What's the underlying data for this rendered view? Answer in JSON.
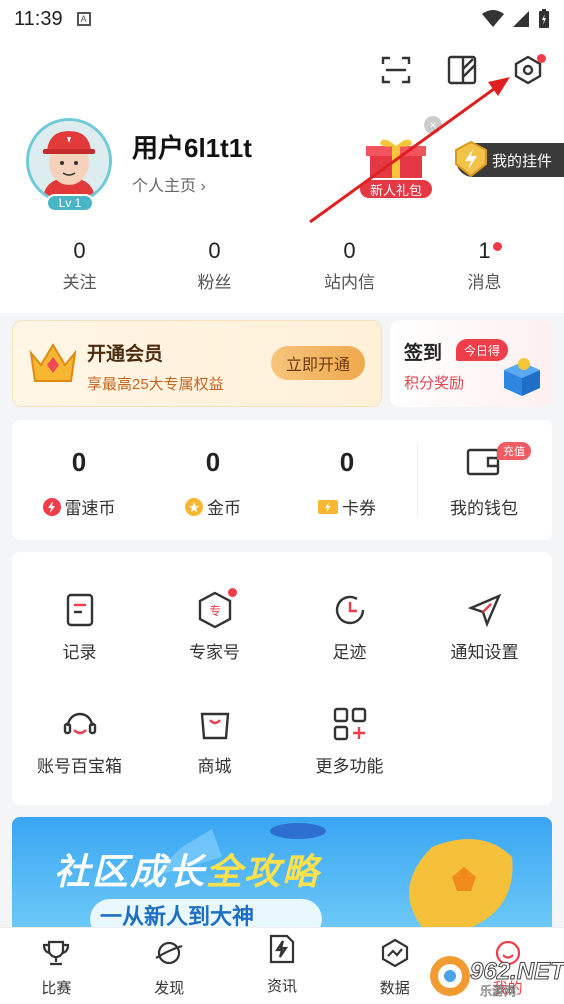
{
  "status_bar": {
    "time": "11:39"
  },
  "profile": {
    "username": "用户6l1t1t",
    "homepage_link": "个人主页 ›",
    "level": "Lv 1",
    "gift_label": "新人礼包",
    "pendant_label": "我的挂件"
  },
  "stats": [
    {
      "value": "0",
      "label": "关注"
    },
    {
      "value": "0",
      "label": "粉丝"
    },
    {
      "value": "0",
      "label": "站内信"
    },
    {
      "value": "1",
      "label": "消息"
    }
  ],
  "vip": {
    "title": "开通会员",
    "subtitle": "享最高25大专属权益",
    "button": "立即开通"
  },
  "checkin": {
    "title": "签到",
    "tag": "今日得",
    "subtitle": "积分奖励"
  },
  "wallet": {
    "items": [
      {
        "value": "0",
        "label": "雷速币"
      },
      {
        "value": "0",
        "label": "金币"
      },
      {
        "value": "0",
        "label": "卡券"
      }
    ],
    "wallet_label": "我的钱包",
    "recharge_tag": "充值"
  },
  "tools": [
    {
      "label": "记录"
    },
    {
      "label": "专家号"
    },
    {
      "label": "足迹"
    },
    {
      "label": "通知设置"
    },
    {
      "label": "账号百宝箱"
    },
    {
      "label": "商城"
    },
    {
      "label": "更多功能"
    }
  ],
  "banner": {
    "title_a": "社区成长",
    "title_b": "全攻略",
    "subtitle": "一从新人到大神"
  },
  "tabs": [
    {
      "label": "比赛"
    },
    {
      "label": "发现"
    },
    {
      "label": "资讯"
    },
    {
      "label": "数据"
    },
    {
      "label": "我的"
    }
  ],
  "watermark": {
    "text": "962.NET",
    "sub": "乐游网"
  },
  "colors": {
    "accent_red": "#ef3e4a",
    "vip_gold": "#f0a84d",
    "teal": "#4ab5c4"
  }
}
